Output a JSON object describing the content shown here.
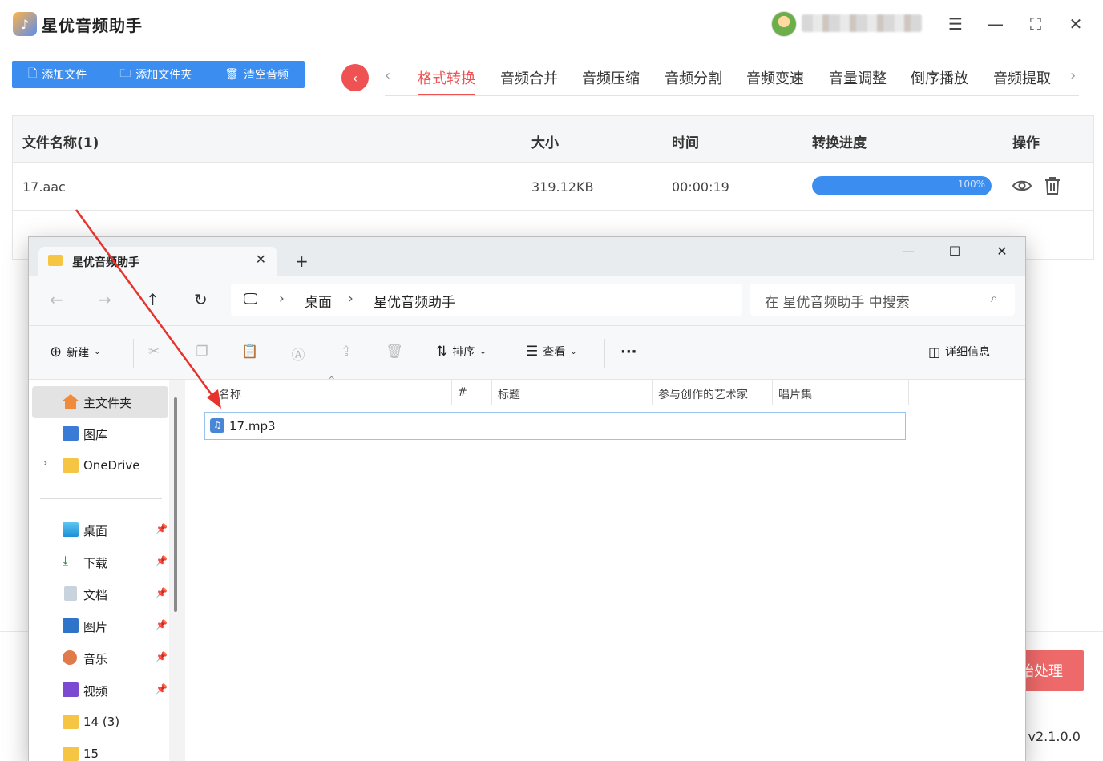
{
  "app": {
    "title": "星优音频助手",
    "toolbar": {
      "add_file": "添加文件",
      "add_folder": "添加文件夹",
      "clear": "清空音频"
    },
    "tabs": [
      "格式转换",
      "音频合并",
      "音频压缩",
      "音频分割",
      "音频变速",
      "音量调整",
      "倒序播放",
      "音频提取"
    ],
    "active_tab": "格式转换",
    "table": {
      "headers": {
        "name": "文件名称(1)",
        "size": "大小",
        "time": "时间",
        "progress": "转换进度",
        "ops": "操作"
      },
      "rows": [
        {
          "name": "17.aac",
          "size": "319.12KB",
          "time": "00:00:19",
          "progress_label": "100%",
          "progress": 1.0
        }
      ]
    },
    "start_button": "始处理",
    "version": ": v2.1.0.0",
    "accent": "#ee5253",
    "primary": "#3b8ef0"
  },
  "explorer": {
    "tab_title": "星优音频助手",
    "breadcrumb": [
      "桌面",
      "星优音频助手"
    ],
    "search_placeholder": "在 星优音频助手 中搜索",
    "commands": {
      "new": "新建",
      "sort": "排序",
      "view": "查看",
      "more": "···",
      "details": "详细信息"
    },
    "sidebar": [
      {
        "label": "主文件夹",
        "icon": "home-icon"
      },
      {
        "label": "图库",
        "icon": "gallery-icon"
      },
      {
        "label": "OneDrive",
        "icon": "folder-icon"
      },
      {
        "label": "桌面",
        "icon": "desktop-icon"
      },
      {
        "label": "下载",
        "icon": "download-icon"
      },
      {
        "label": "文档",
        "icon": "document-icon"
      },
      {
        "label": "图片",
        "icon": "picture-icon"
      },
      {
        "label": "音乐",
        "icon": "music-icon"
      },
      {
        "label": "视频",
        "icon": "video-icon"
      },
      {
        "label": "14 (3)",
        "icon": "folder-icon"
      },
      {
        "label": "15",
        "icon": "folder-icon"
      }
    ],
    "columns": [
      "名称",
      "#",
      "标题",
      "参与创作的艺术家",
      "唱片集"
    ],
    "files": [
      {
        "name": "17.mp3"
      }
    ]
  }
}
